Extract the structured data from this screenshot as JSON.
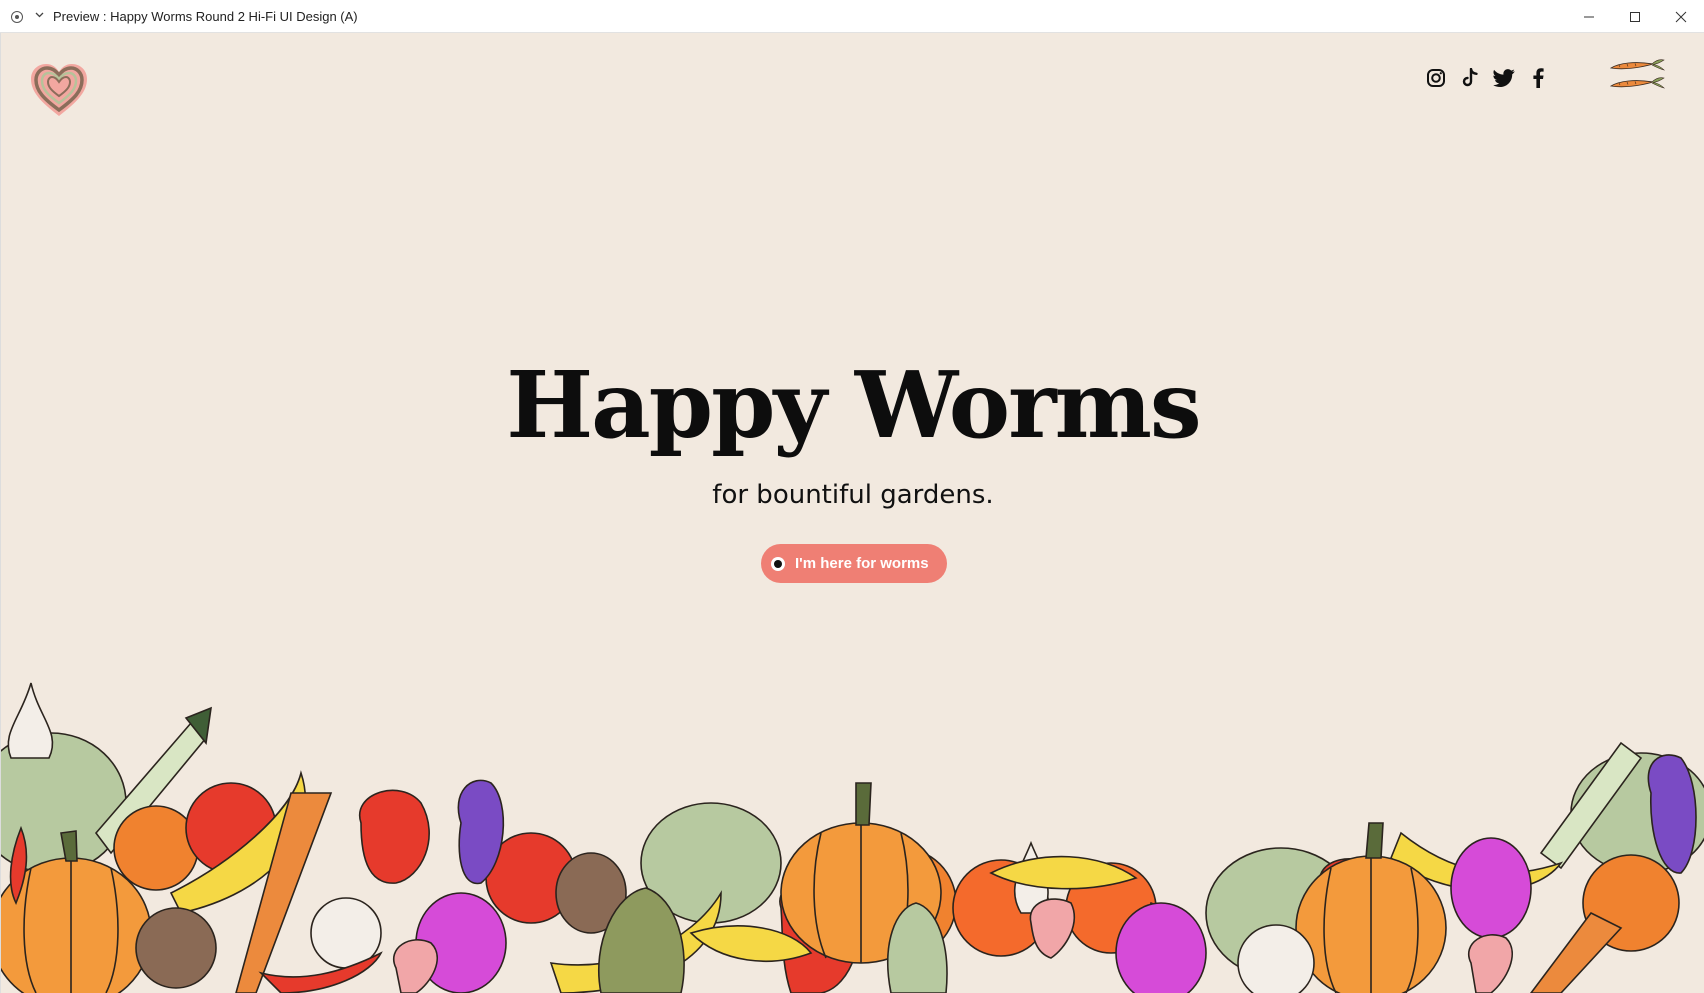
{
  "window": {
    "title": "Preview : Happy Worms Round 2 Hi-Fi UI Design (A)",
    "controls": [
      "minimize-icon",
      "maximize-icon",
      "close-icon"
    ]
  },
  "header": {
    "logo": "heart-logo-icon",
    "social": [
      "instagram-icon",
      "tiktok-icon",
      "twitter-icon",
      "facebook-icon"
    ],
    "menu": "carrot-menu-icon"
  },
  "hero": {
    "title": "Happy Worms",
    "subtitle": "for bountiful gardens.",
    "cta_label": "I'm here for worms"
  },
  "colors": {
    "background": "#f2e9df",
    "cta": "#ef7f74",
    "heart_outer": "#f2a7a0",
    "heart_inner": "#8b6d5a",
    "title": "#0d0d0d"
  },
  "illustration": "vegetables-border-illustration"
}
